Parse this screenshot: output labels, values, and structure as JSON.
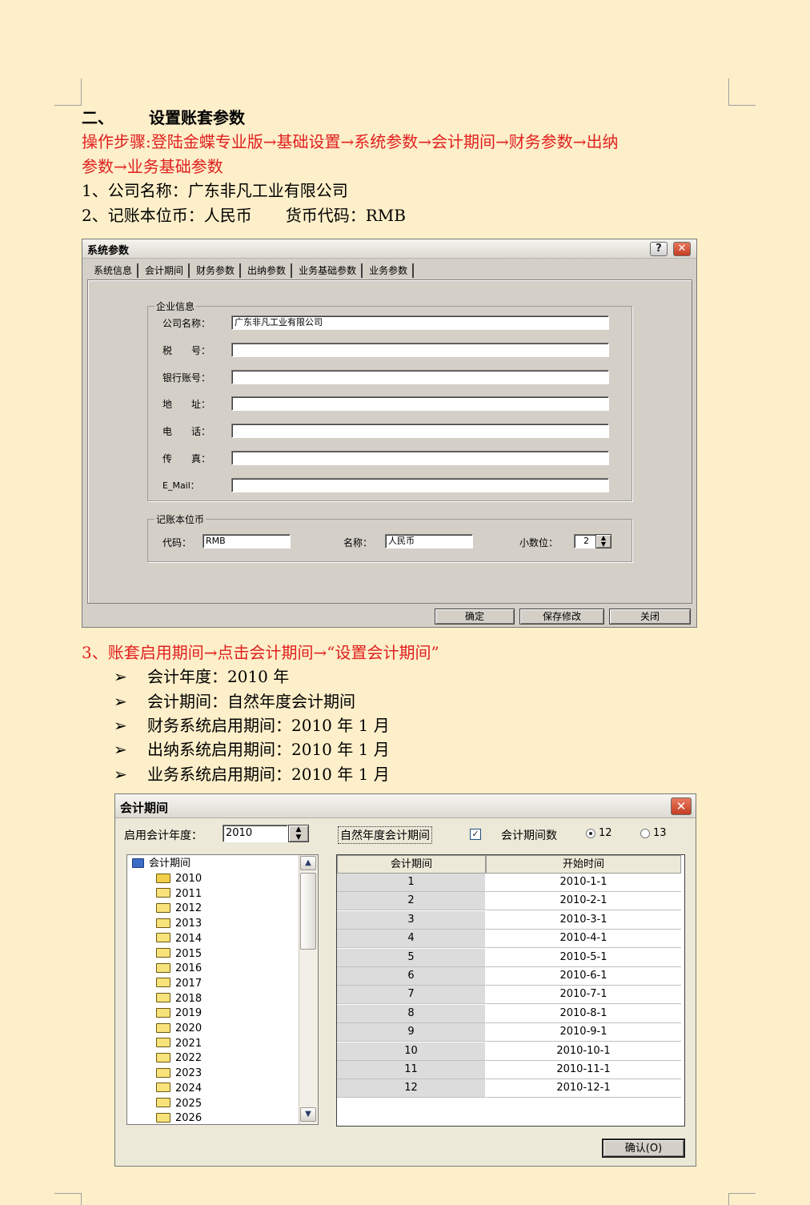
{
  "doc": {
    "heading_num": "二、",
    "heading": "设置账套参数",
    "steps_line1": "操作步骤:登陆金蝶专业版→基础设置→系统参数→会计期间→财务参数→出纳",
    "steps_line2": "参数→业务基础参数",
    "item1": "1、公司名称：广东非凡工业有限公司",
    "item2a": "2、记账本位币：人民币",
    "item2b": "货币代码：RMB",
    "item3": "3、账套启用期间→点击会计期间→“设置会计期间”",
    "bullet_glyph": "➢",
    "bullets": [
      "会计年度：2010 年",
      "会计期间：自然年度会计期间",
      "财务系统启用期间：2010 年 1 月",
      "出纳系统启用期间：2010 年 1 月",
      "业务系统启用期间：2010 年 1 月"
    ]
  },
  "dlg1": {
    "title": "系统参数",
    "help": "?",
    "close": "✕",
    "tabs": [
      "系统信息",
      "会计期间",
      "财务参数",
      "出纳参数",
      "业务基础参数",
      "业务参数"
    ],
    "group1": "企业信息",
    "fields": [
      {
        "label": "公司名称：",
        "value": "广东非凡工业有限公司"
      },
      {
        "label": "税　　号：",
        "value": ""
      },
      {
        "label": "银行账号：",
        "value": ""
      },
      {
        "label": "地　　址：",
        "value": ""
      },
      {
        "label": "电　　话：",
        "value": ""
      },
      {
        "label": "传　　真：",
        "value": ""
      },
      {
        "label": "E_Mail：",
        "value": ""
      }
    ],
    "group2": "记账本位币",
    "code_label": "代码：",
    "code_value": "RMB",
    "name_label": "名称：",
    "name_value": "人民币",
    "decimal_label": "小数位：",
    "decimal_value": "2",
    "btn_ok": "确定",
    "btn_save": "保存修改",
    "btn_close": "关闭"
  },
  "dlg2": {
    "title": "会计期间",
    "close": "✕",
    "year_label": "启用会计年度：",
    "year_value": "2010",
    "natural_label": "自然年度会计期间",
    "natural_checked": "✓",
    "count_label": "会计期间数",
    "opt12": "12",
    "opt13": "13",
    "tree_root": "会计期间",
    "years": [
      "2010",
      "2011",
      "2012",
      "2013",
      "2014",
      "2015",
      "2016",
      "2017",
      "2018",
      "2019",
      "2020",
      "2021",
      "2022",
      "2023",
      "2024",
      "2025",
      "2026"
    ],
    "col_period": "会计期间",
    "col_start": "开始时间",
    "rows": [
      [
        "1",
        "2010-1-1"
      ],
      [
        "2",
        "2010-2-1"
      ],
      [
        "3",
        "2010-3-1"
      ],
      [
        "4",
        "2010-4-1"
      ],
      [
        "5",
        "2010-5-1"
      ],
      [
        "6",
        "2010-6-1"
      ],
      [
        "7",
        "2010-7-1"
      ],
      [
        "8",
        "2010-8-1"
      ],
      [
        "9",
        "2010-9-1"
      ],
      [
        "10",
        "2010-10-1"
      ],
      [
        "11",
        "2010-11-1"
      ],
      [
        "12",
        "2010-12-1"
      ]
    ],
    "confirm": "确认(O)"
  }
}
